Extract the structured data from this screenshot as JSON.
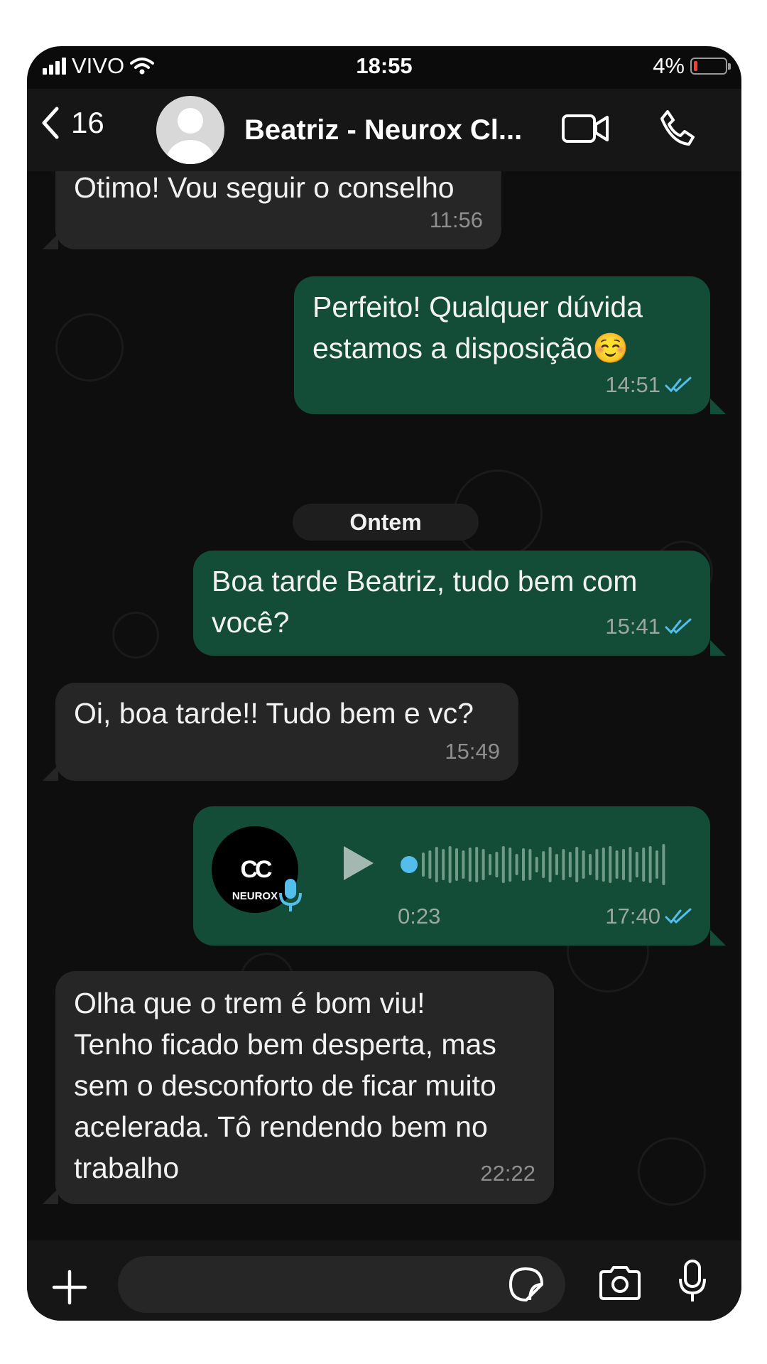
{
  "status_bar": {
    "carrier": "VIVO",
    "time": "18:55",
    "battery": "4%"
  },
  "header": {
    "back_count": "16",
    "contact_name": "Beatriz - Neurox Cl..."
  },
  "messages": [
    {
      "direction": "in",
      "text": "Otimo! Vou seguir o conselho",
      "time": "11:56"
    },
    {
      "direction": "out",
      "text_line1": "Perfeito! Qualquer dúvida",
      "text_line2": "estamos a disposição☺️",
      "time": "14:51",
      "read": true
    },
    {
      "direction": "out",
      "text_line1": "Boa tarde Beatriz, tudo bem com",
      "text_line2": "você?",
      "time": "15:41",
      "read": true
    },
    {
      "direction": "in",
      "text": "Oi, boa tarde!! Tudo bem e vc?",
      "time": "15:49"
    },
    {
      "direction": "out",
      "type": "audio",
      "avatar_brand": "NEUROX",
      "duration": "0:23",
      "time": "17:40",
      "read": true
    },
    {
      "direction": "in",
      "lines": [
        "Olha que o trem é bom viu!",
        "Tenho ficado bem desperta, mas",
        "sem o desconforto de ficar muito",
        "acelerada. Tô rendendo bem no",
        "trabalho"
      ],
      "time": "22:22"
    }
  ],
  "date_separator": "Ontem",
  "icons": {
    "back": "chevron-left-icon",
    "video": "video-call-icon",
    "call": "phone-icon",
    "attach": "plus-icon",
    "sticker": "sticker-icon",
    "camera": "camera-icon",
    "mic": "microphone-icon"
  },
  "colors": {
    "outgoing": "#144d37",
    "incoming": "#262626",
    "read_ticks": "#53bdeb"
  }
}
